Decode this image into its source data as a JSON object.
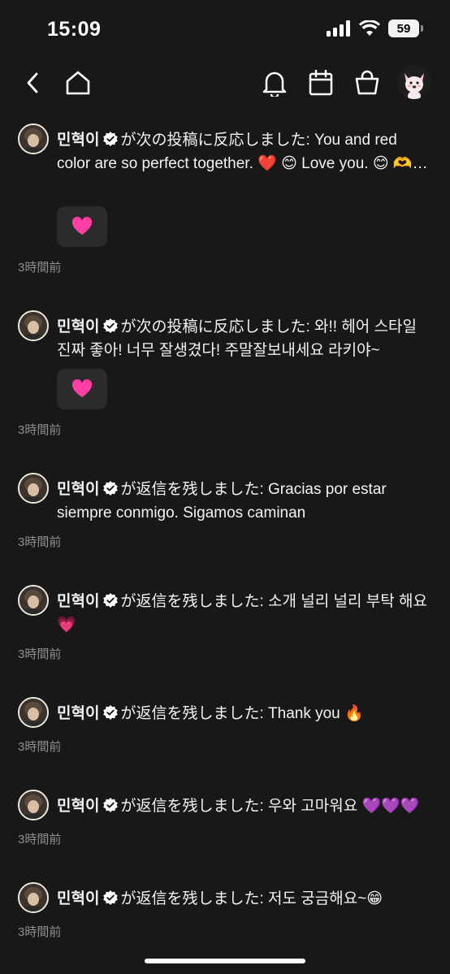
{
  "status": {
    "time": "15:09",
    "battery": "59"
  },
  "nav": {
    "icons": [
      "back-icon",
      "home-icon",
      "bell-icon",
      "calendar-icon",
      "shopping-bag-icon",
      "profile-avatar"
    ]
  },
  "feed": [
    {
      "name": "민혁이",
      "action": "が次の投稿に反応しました:",
      "message": "You and red color are so perfect together. ❤️ 😊 Love you. 😊 🫶…",
      "reaction": "heart",
      "time": "3時間前"
    },
    {
      "name": "민혁이",
      "action": "が次の投稿に反応しました:",
      "message": "와!! 헤어 스타일 진짜 좋아! 너무 잘생겼다! 주말잘보내세요 라키야~",
      "reaction": "heart",
      "time": "3時間前"
    },
    {
      "name": "민혁이",
      "action": "が返信を残しました:",
      "message": "Gracias por estar siempre conmigo. Sigamos caminan",
      "time": "3時間前"
    },
    {
      "name": "민혁이",
      "action": "が返信を残しました:",
      "message": "소개 널리 널리 부탁 해요 💗",
      "time": "3時間前"
    },
    {
      "name": "민혁이",
      "action": "が返信を残しました:",
      "message": "Thank you 🔥",
      "time": "3時間前"
    },
    {
      "name": "민혁이",
      "action": "が返信を残しました:",
      "message": "우와 고마워요 💜💜💜",
      "time": "3時間前"
    },
    {
      "name": "민혁이",
      "action": "が返信を残しました:",
      "message": "저도 궁금해요~😁",
      "time": "3時間前"
    }
  ],
  "colors": {
    "background": "#181818",
    "reaction_heart": "#ff3fa4",
    "timestamp": "#8e8e8e"
  }
}
